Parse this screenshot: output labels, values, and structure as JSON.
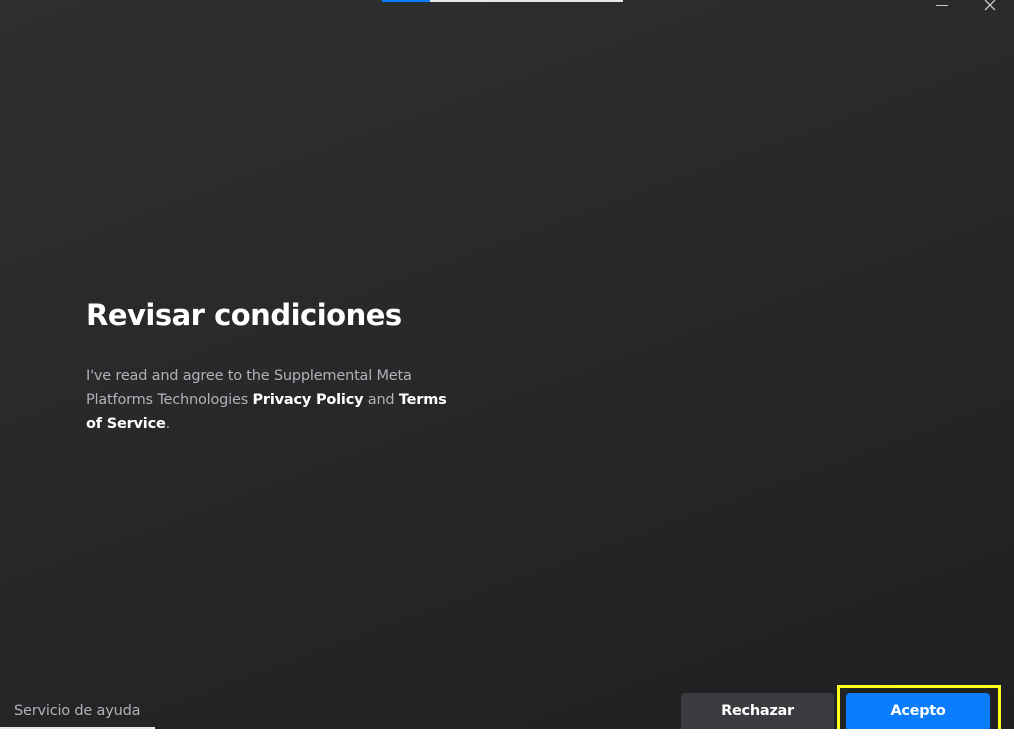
{
  "window": {
    "progress_fraction": 0.2,
    "controls": {
      "minimize_icon": "minimize-icon",
      "close_icon": "close-icon"
    }
  },
  "content": {
    "title": "Revisar condiciones",
    "terms": {
      "prefix": "I've read and agree to the Supplemental Meta Platforms Technologies ",
      "privacy_link": "Privacy Policy",
      "middle": " and ",
      "terms_link": "Terms of Service",
      "suffix": "."
    }
  },
  "footer": {
    "help_link": "Servicio de ayuda",
    "reject_label": "Rechazar",
    "accept_label": "Acepto"
  },
  "colors": {
    "background": "#2b2c2e",
    "accent": "#0a7cff",
    "secondary_button": "#3a3b3e",
    "highlight": "#ffff1a"
  }
}
